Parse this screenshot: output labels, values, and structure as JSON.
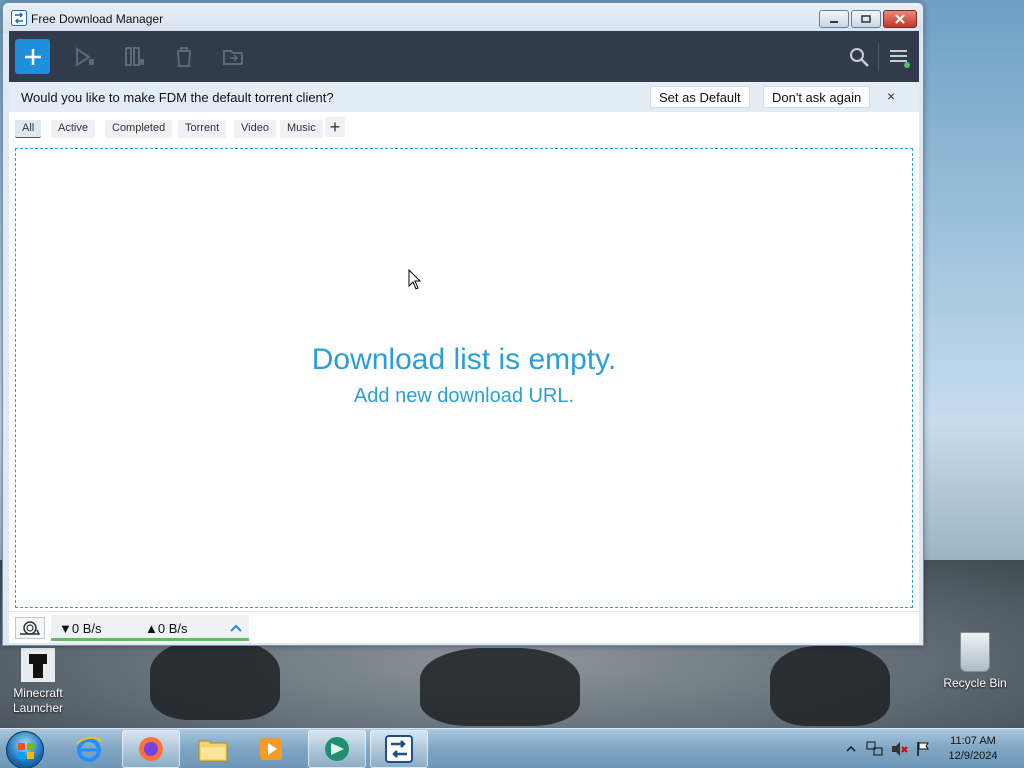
{
  "window": {
    "title": "Free Download Manager"
  },
  "toolbar": {
    "add_icon": "plus-icon",
    "icons": [
      "play-icon",
      "pause-icon",
      "trash-icon",
      "folder-icon",
      "search-icon",
      "menu-icon"
    ],
    "accent": "#1d8fdb"
  },
  "infobar": {
    "message": "Would you like to make FDM the default torrent client?",
    "set_default": "Set as Default",
    "dont_ask": "Don't ask again",
    "close": "×"
  },
  "tabs": [
    {
      "label": "All",
      "active": true
    },
    {
      "label": "Active"
    },
    {
      "label": "Completed"
    },
    {
      "label": "Torrent"
    },
    {
      "label": "Video"
    },
    {
      "label": "Music"
    }
  ],
  "tab_add": "+",
  "empty": {
    "title": "Download list is empty.",
    "subtitle": "Add new download URL."
  },
  "status": {
    "download_speed": "▼0 B/s",
    "upload_speed": "▲0 B/s",
    "toggle": "^"
  },
  "desktop": {
    "icons": [
      {
        "label": "Minecraft Launcher"
      },
      {
        "label": "Recycle Bin"
      }
    ]
  },
  "taskbar": {
    "apps": [
      "internet-explorer-icon",
      "firefox-icon",
      "file-explorer-icon",
      "media-player-icon",
      "green-app-icon",
      "fdm-icon"
    ],
    "time": "11:07 AM",
    "date": "12/9/2024"
  }
}
